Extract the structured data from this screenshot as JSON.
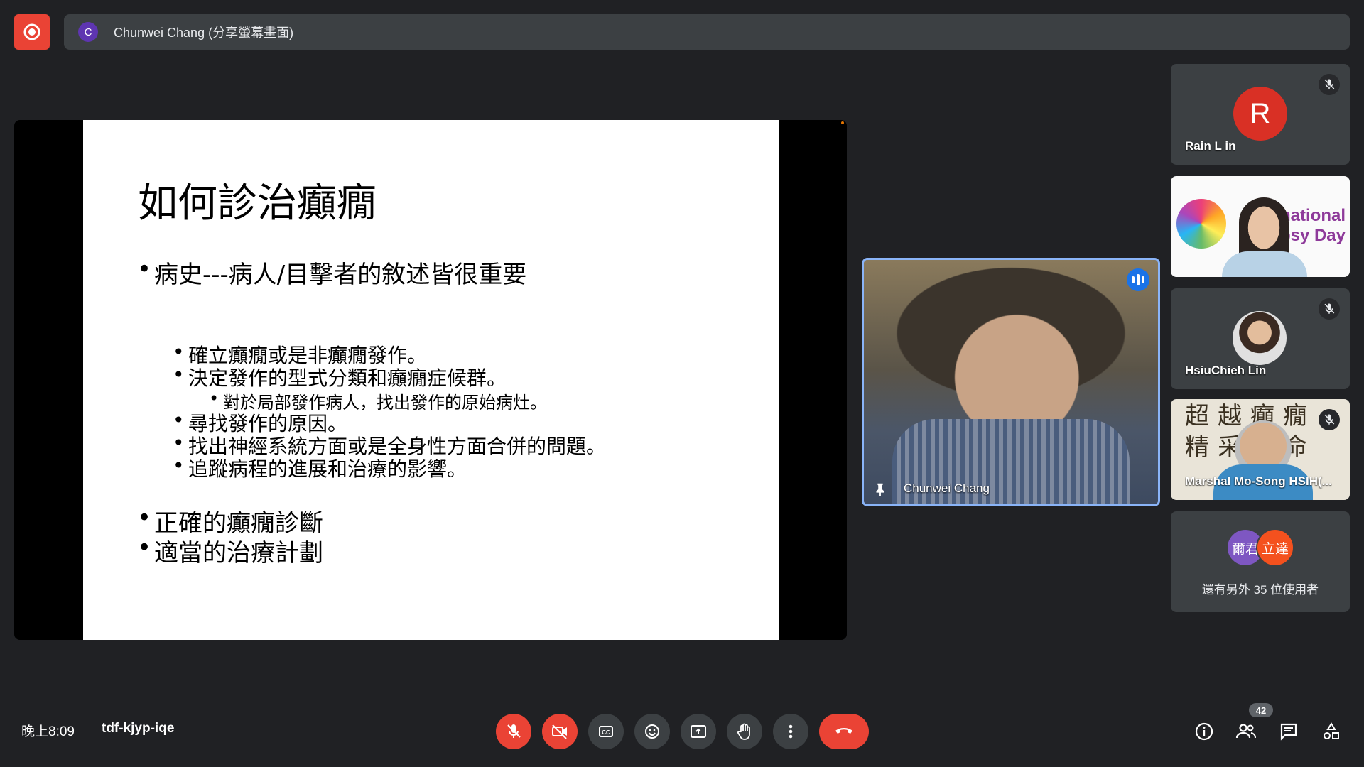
{
  "top_bar": {
    "presenter_initial": "C",
    "presenter_label": "Chunwei Chang (分享螢幕畫面)"
  },
  "slide": {
    "title": "如何診治癲癇",
    "bullets_level1_top": [
      "病史---病人/目擊者的敘述皆很重要"
    ],
    "bullets_level2": [
      "確立癲癇或是非癲癇發作。",
      "決定發作的型式分類和癲癇症候群。",
      "尋找發作的原因。",
      "找出神經系統方面或是全身性方面合併的問題。",
      "追蹤病程的進展和治療的影響。"
    ],
    "bullet_level3": "對於局部發作病人，找出發作的原始病灶。",
    "bullets_level1_bottom": [
      "正確的癲癇診斷",
      "適當的治療計劃"
    ]
  },
  "speaker": {
    "name": "Chunwei Chang"
  },
  "participants": [
    {
      "name": "Rain L in",
      "avatar_letter": "R",
      "muted": true
    },
    {
      "name": "",
      "video_text": [
        "national",
        "psy Day"
      ],
      "muted": false
    },
    {
      "name": "HsiuChieh Lin",
      "muted": true
    },
    {
      "name": "Marshal Mo-Song HSIH(...",
      "video_text": "超越癲癇\n精采命",
      "muted": true
    }
  ],
  "others": {
    "avatars": [
      {
        "label": "爾君",
        "color": "#7e57c2"
      },
      {
        "label": "立達",
        "color": "#f4511e"
      }
    ],
    "text": "還有另外 35 位使用者"
  },
  "bottom_bar": {
    "time": "晚上8:09",
    "meeting_code": "tdf-kjyp-iqe",
    "controls": [
      "mic-off-icon",
      "camera-off-icon",
      "captions-icon",
      "emoji-icon",
      "present-icon",
      "raise-hand-icon",
      "more-icon",
      "hangup-icon"
    ],
    "people_count": "42"
  },
  "colors": {
    "background": "#202124",
    "surface": "#3c4043",
    "danger": "#ea4335",
    "accent": "#8ab4f8"
  }
}
